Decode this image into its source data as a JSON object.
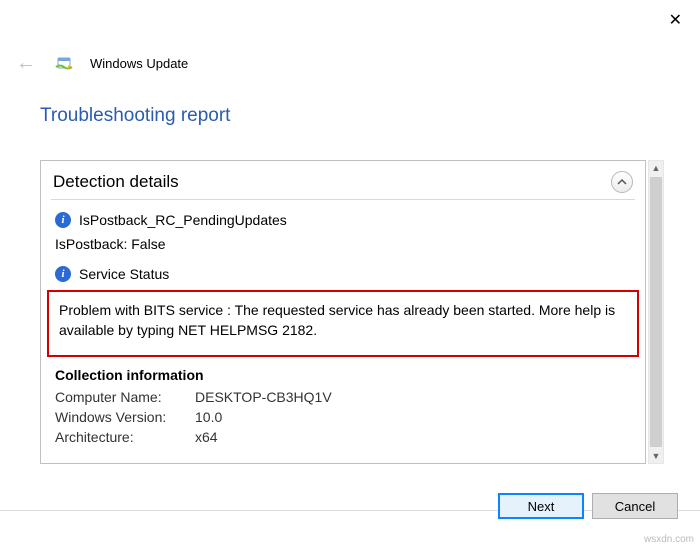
{
  "window": {
    "title": "Windows Update"
  },
  "page": {
    "heading": "Troubleshooting report"
  },
  "detection": {
    "section_title": "Detection details",
    "item1": "IsPostback_RC_PendingUpdates",
    "item1_sub": "IsPostback: False",
    "item2": "Service Status",
    "problem": "Problem with BITS service : The requested service has already been started. More help is available by typing NET HELPMSG 2182."
  },
  "collection": {
    "title": "Collection information",
    "rows": [
      {
        "label": "Computer Name:",
        "value": "DESKTOP-CB3HQ1V"
      },
      {
        "label": "Windows Version:",
        "value": "10.0"
      },
      {
        "label": "Architecture:",
        "value": "x64"
      }
    ]
  },
  "buttons": {
    "next": "Next",
    "cancel": "Cancel"
  },
  "watermark": "wsxdn.com"
}
